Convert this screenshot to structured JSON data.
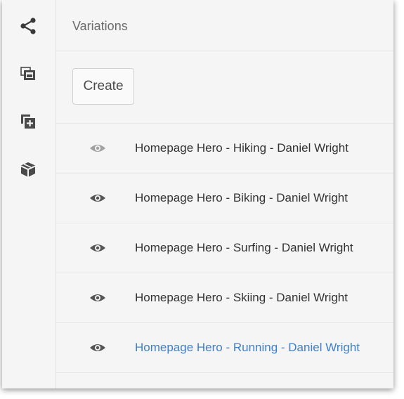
{
  "panel": {
    "title": "Variations",
    "create_label": "Create"
  },
  "rail": {
    "icons": [
      "share-icon",
      "gallery-icon",
      "add-collection-icon",
      "package-icon"
    ]
  },
  "variations": [
    {
      "label": "Homepage Hero - Hiking - Daniel Wright",
      "state": "default"
    },
    {
      "label": "Homepage Hero - Biking - Daniel Wright",
      "state": "default"
    },
    {
      "label": "Homepage Hero - Surfing - Daniel Wright",
      "state": "default"
    },
    {
      "label": "Homepage Hero - Skiing - Daniel Wright",
      "state": "default"
    },
    {
      "label": "Homepage Hero - Running - Daniel Wright",
      "state": "active"
    }
  ],
  "colors": {
    "active_link": "#3f7fc9",
    "icon": "#4a4a4a",
    "background": "#f5f5f5"
  }
}
